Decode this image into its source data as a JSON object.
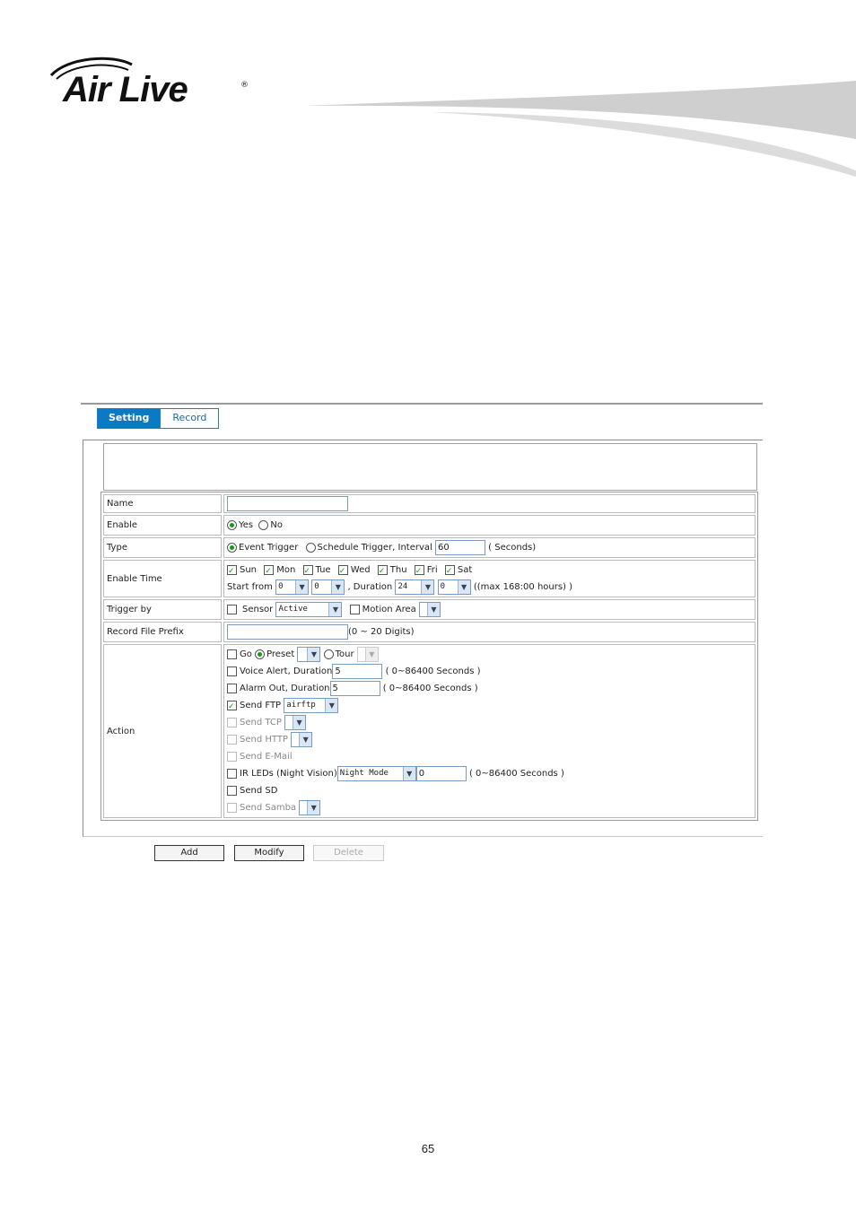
{
  "logo": {
    "text": "Air Live",
    "reg": "®"
  },
  "tabs": [
    {
      "label": "Setting"
    },
    {
      "label": "Record"
    }
  ],
  "form": {
    "name": {
      "label": "Name",
      "value": ""
    },
    "enable": {
      "label": "Enable",
      "yes": "Yes",
      "no": "No",
      "selected": "Yes"
    },
    "type": {
      "label": "Type",
      "event": "Event Trigger",
      "schedule": "Schedule Trigger, Interval",
      "interval": "60",
      "unit": "( Seconds)"
    },
    "enable_time": {
      "label": "Enable Time",
      "days": [
        {
          "label": "Sun",
          "checked": true
        },
        {
          "label": "Mon",
          "checked": true
        },
        {
          "label": "Tue",
          "checked": true
        },
        {
          "label": "Wed",
          "checked": true
        },
        {
          "label": "Thu",
          "checked": true
        },
        {
          "label": "Fri",
          "checked": true
        },
        {
          "label": "Sat",
          "checked": true
        }
      ],
      "start_from": "Start from",
      "start_h": "0",
      "start_m": "0",
      "duration_label": ", Duration",
      "dur_h": "24",
      "dur_m": "0",
      "max_note": "((max 168:00 hours) )"
    },
    "trigger_by": {
      "label": "Trigger by",
      "sensor": "Sensor",
      "sensor_value": "Active",
      "motion": "Motion Area"
    },
    "prefix": {
      "label": "Record File Prefix",
      "value": "",
      "note": "(0 ~ 20 Digits)"
    },
    "action": {
      "label": "Action",
      "go": "Go",
      "preset": "Preset",
      "tour": "Tour",
      "voice": "Voice Alert, Duration",
      "voice_val": "5",
      "voice_unit": "( 0~86400 Seconds )",
      "alarm": "Alarm Out, Duration",
      "alarm_val": "5",
      "alarm_unit": "( 0~86400 Seconds )",
      "ftp": "Send FTP",
      "ftp_val": "airftp",
      "tcp": "Send TCP",
      "http": "Send HTTP",
      "email": "Send E-Mail",
      "ir": "IR LEDs (Night Vision)",
      "ir_mode": "Night Mode",
      "ir_val": "0",
      "ir_unit": "( 0~86400 Seconds )",
      "sd": "Send SD",
      "samba": "Send Samba"
    }
  },
  "buttons": {
    "add": "Add",
    "modify": "Modify",
    "delete": "Delete"
  },
  "page_number": "65"
}
